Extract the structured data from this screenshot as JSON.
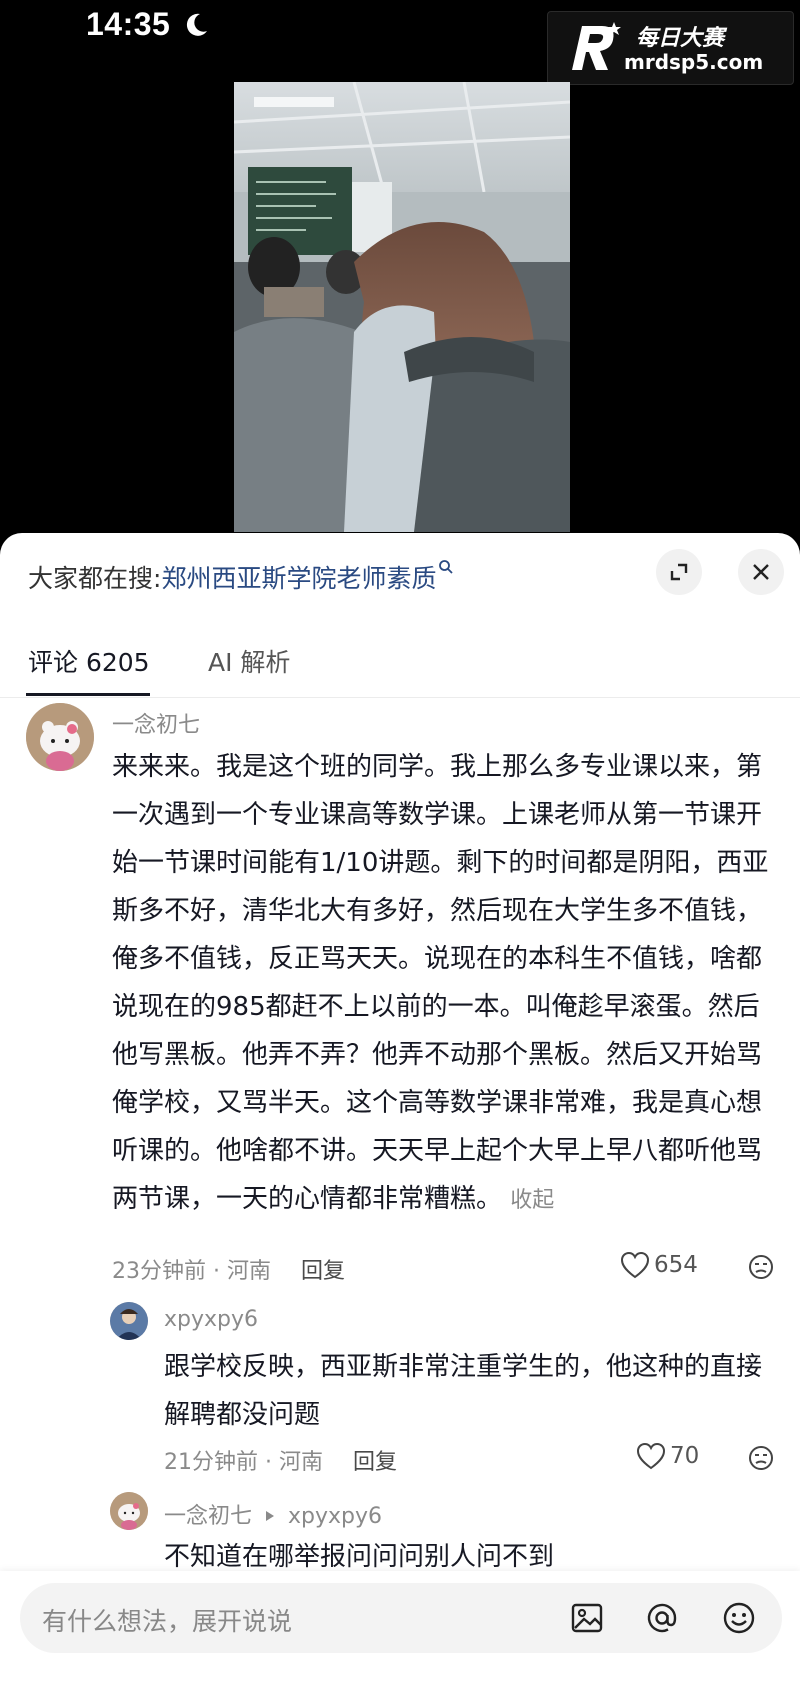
{
  "status_bar": {
    "time": "14:35",
    "moon_icon": "moon-icon"
  },
  "watermark": {
    "brand_cn": "每日大赛",
    "url": "mrdsp5.com"
  },
  "panel": {
    "search": {
      "prefix": "大家都在搜:",
      "term": "郑州西亚斯学院老师素质",
      "icon": "search-icon"
    },
    "tabs": [
      {
        "label": "评论 6205",
        "active": true
      },
      {
        "label": "AI 解析",
        "active": false
      }
    ],
    "comments": [
      {
        "username": "一念初七",
        "text": "来来来。我是这个班的同学。我上那么多专业课以来，第一次遇到一个专业课高等数学课。上课老师从第一节课开始一节课时间能有1/10讲题。剩下的时间都是阴阳，西亚斯多不好，清华北大有多好，然后现在大学生多不值钱，俺多不值钱，反正骂天天。说现在的本科生不值钱，啥都说现在的985都赶不上以前的一本。叫俺趁早滚蛋。然后他写黑板。他弄不弄？他弄不动那个黑板。然后又开始骂俺学校，又骂半天。这个高等数学课非常难，我是真心想听课的。他啥都不讲。天天早上起个大早上早八都听他骂两节课，一天的心情都非常糟糕。",
        "collapse_label": "收起",
        "time_location": "23分钟前 · 河南",
        "reply_label": "回复",
        "likes": "654"
      },
      {
        "username": "xpyxpy6",
        "text": "跟学校反映，西亚斯非常注重学生的，他这种的直接解聘都没问题",
        "time_location": "21分钟前 · 河南",
        "reply_label": "回复",
        "likes": "70"
      },
      {
        "username": "一念初七",
        "reply_to": "xpyxpy6",
        "text": "不知道在哪举报问问问别人问不到"
      }
    ],
    "input": {
      "placeholder": "有什么想法，展开说说",
      "icons": [
        "image-icon",
        "at-icon",
        "emoji-icon"
      ]
    }
  }
}
